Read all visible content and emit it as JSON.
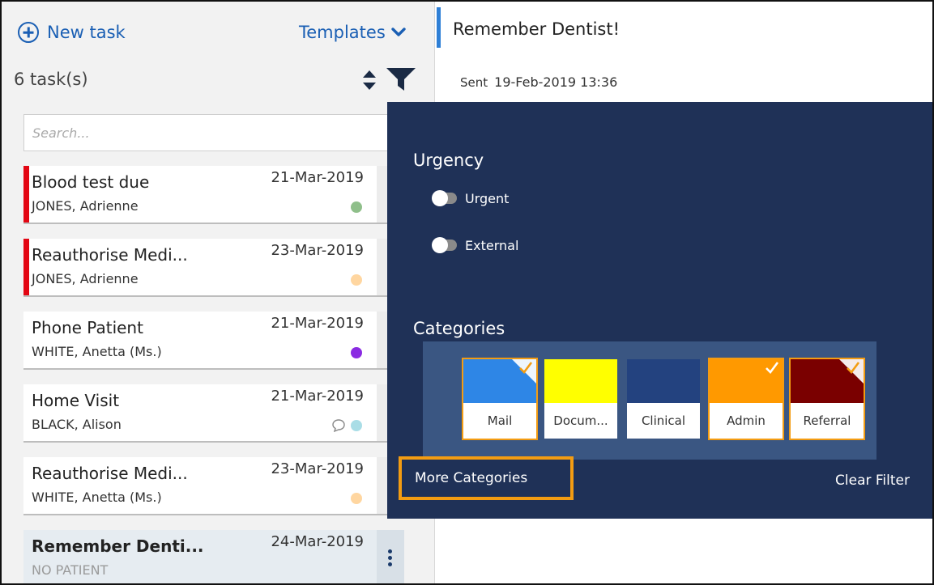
{
  "header": {
    "new_task_label": "New task",
    "templates_label": "Templates",
    "task_count": "6 task(s)"
  },
  "search": {
    "placeholder": "Search..."
  },
  "tasks": [
    {
      "title": "Blood test due",
      "patient": "JONES, Adrienne",
      "date": "21-Mar-2019",
      "dot_color": "#8fbf8a",
      "urgent": true
    },
    {
      "title": "Reauthorise Medi...",
      "patient": "JONES, Adrienne",
      "date": "23-Mar-2019",
      "dot_color": "#ffd6a0",
      "urgent": true
    },
    {
      "title": "Phone Patient",
      "patient": "WHITE, Anetta (Ms.)",
      "date": "21-Mar-2019",
      "dot_color": "#8a2be2",
      "urgent": false
    },
    {
      "title": "Home Visit",
      "patient": "BLACK, Alison",
      "date": "21-Mar-2019",
      "dot_color": "#a9dde6",
      "urgent": false,
      "has_comment": true
    },
    {
      "title": "Reauthorise Medi...",
      "patient": "WHITE, Anetta (Ms.)",
      "date": "23-Mar-2019",
      "dot_color": "#ffd6a0",
      "urgent": false
    },
    {
      "title": "Remember Denti...",
      "patient": "NO PATIENT",
      "date": "24-Mar-2019",
      "dot_color": "",
      "urgent": false,
      "selected": true
    }
  ],
  "detail": {
    "title": "Remember Dentist!",
    "sent_label": "Sent",
    "sent_value": "19-Feb-2019 13:36"
  },
  "filter": {
    "urgency_heading": "Urgency",
    "toggles": [
      {
        "label": "Urgent",
        "on": false
      },
      {
        "label": "External",
        "on": false
      }
    ],
    "categories_heading": "Categories",
    "categories": [
      {
        "label": "Mail",
        "color": "#2e86e6",
        "selected": true
      },
      {
        "label": "Docum...",
        "color": "#ffff00",
        "selected": false
      },
      {
        "label": "Clinical",
        "color": "#23427f",
        "selected": false
      },
      {
        "label": "Admin",
        "color": "#ff9900",
        "selected": true
      },
      {
        "label": "Referral",
        "color": "#7a0000",
        "selected": true
      }
    ],
    "more_categories_label": "More Categories",
    "clear_filter_label": "Clear Filter"
  },
  "colors": {
    "accent_blue": "#1a5fb4",
    "overlay_bg": "#1f3157",
    "highlight_orange": "#f39c12",
    "urgent_red": "#e30613"
  }
}
